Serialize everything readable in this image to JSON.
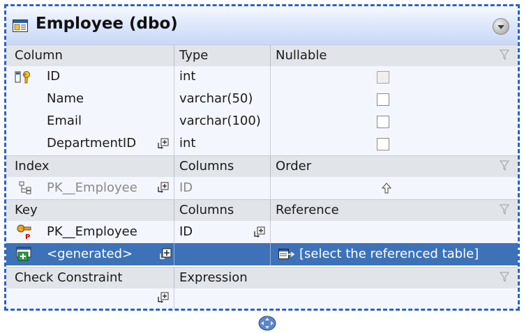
{
  "table": {
    "title": "Employee (dbo)"
  },
  "columns_section": {
    "headers": [
      "Column",
      "Type",
      "Nullable"
    ],
    "rows": [
      {
        "name": "ID",
        "type": "int",
        "nullable": false,
        "nullable_disabled": true,
        "is_pk": true
      },
      {
        "name": "Name",
        "type": "varchar(50)",
        "nullable": false
      },
      {
        "name": "Email",
        "type": "varchar(100)",
        "nullable": false
      },
      {
        "name": "DepartmentID",
        "type": "int",
        "nullable": false
      }
    ]
  },
  "index_section": {
    "headers": [
      "Index",
      "Columns",
      "Order"
    ],
    "rows": [
      {
        "name": "PK__Employee",
        "columns": "ID",
        "order_icon": "arrow-up-icon"
      }
    ]
  },
  "key_section": {
    "headers": [
      "Key",
      "Columns",
      "Reference"
    ],
    "rows": [
      {
        "name": "PK__Employee",
        "columns": "ID",
        "reference": ""
      },
      {
        "name": "<generated>",
        "columns": "",
        "reference": "[select the referenced table]",
        "selected": true
      }
    ]
  },
  "check_section": {
    "headers": [
      "Check Constraint",
      "Expression"
    ]
  },
  "colors": {
    "border": "#2a62c9",
    "header_bg": "#e1e4e9",
    "selection": "#3d72b8",
    "row_bg": "#f3f6fc"
  }
}
